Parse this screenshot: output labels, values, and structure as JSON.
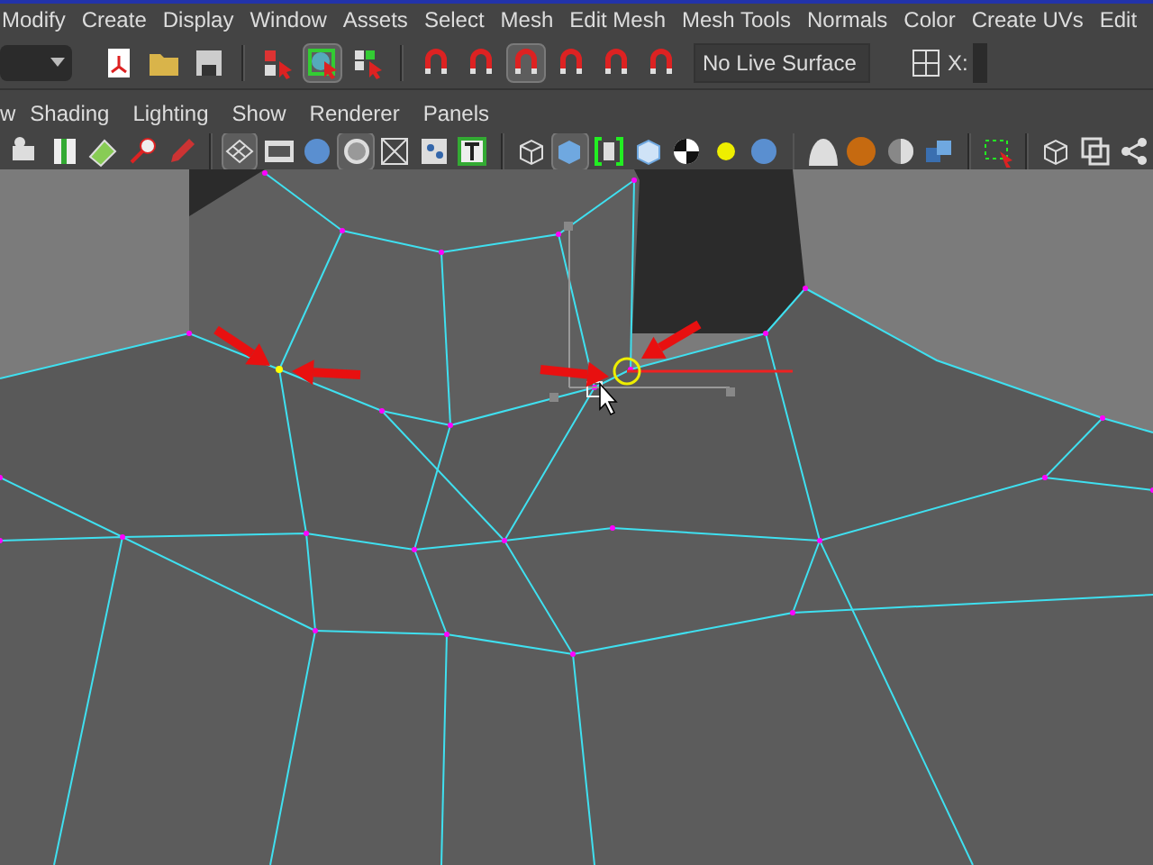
{
  "menu_bar": {
    "items": [
      "Modify",
      "Create",
      "Display",
      "Window",
      "Assets",
      "Select",
      "Mesh",
      "Edit Mesh",
      "Mesh Tools",
      "Normals",
      "Color",
      "Create UVs",
      "Edit"
    ]
  },
  "status_line": {
    "tools": [
      {
        "kind": "new-scene",
        "selected": false
      },
      {
        "kind": "folder",
        "selected": false
      },
      {
        "kind": "save",
        "selected": false
      },
      {
        "kind": "sep"
      },
      {
        "kind": "hierarchy",
        "selected": false
      },
      {
        "kind": "object",
        "selected": true
      },
      {
        "kind": "component",
        "selected": false
      },
      {
        "kind": "sep"
      },
      {
        "kind": "magnet-grid",
        "selected": false
      },
      {
        "kind": "magnet-curve",
        "selected": false
      },
      {
        "kind": "magnet-point",
        "selected": true
      },
      {
        "kind": "magnet-sphere",
        "selected": false
      },
      {
        "kind": "magnet-plane",
        "selected": false
      },
      {
        "kind": "magnet",
        "selected": false
      }
    ],
    "live_surface": "No Live Surface",
    "x_label": "X:"
  },
  "panel_menu": {
    "items": [
      "w",
      "Shading",
      "Lighting",
      "Show",
      "Renderer",
      "Panels"
    ]
  },
  "panel_toolbar": {
    "tools": [
      {
        "kind": "camera",
        "selected": false
      },
      {
        "kind": "book",
        "selected": false
      },
      {
        "kind": "plane",
        "selected": false
      },
      {
        "kind": "wand",
        "selected": false
      },
      {
        "kind": "brush",
        "selected": false
      },
      {
        "kind": "sep"
      },
      {
        "kind": "grid",
        "selected": true
      },
      {
        "kind": "film",
        "selected": false
      },
      {
        "kind": "ball",
        "selected": false
      },
      {
        "kind": "ring",
        "selected": true
      },
      {
        "kind": "xray",
        "selected": false
      },
      {
        "kind": "dots",
        "selected": false
      },
      {
        "kind": "text-frame",
        "selected": false
      },
      {
        "kind": "sep"
      },
      {
        "kind": "wire-cube",
        "selected": false
      },
      {
        "kind": "solid-cube",
        "selected": true
      },
      {
        "kind": "bracket",
        "selected": false
      },
      {
        "kind": "cube",
        "selected": false
      },
      {
        "kind": "checker",
        "selected": false
      },
      {
        "kind": "light",
        "selected": false
      },
      {
        "kind": "ball",
        "selected": false
      },
      {
        "kind": "sep"
      },
      {
        "kind": "dome",
        "selected": false
      },
      {
        "kind": "orange",
        "selected": false
      },
      {
        "kind": "half",
        "selected": false
      },
      {
        "kind": "cubes",
        "selected": false
      },
      {
        "kind": "sep"
      },
      {
        "kind": "marquee",
        "selected": false
      },
      {
        "kind": "sep"
      },
      {
        "kind": "wire-cube",
        "selected": false
      },
      {
        "kind": "copy",
        "selected": false
      },
      {
        "kind": "share",
        "selected": false
      }
    ]
  }
}
